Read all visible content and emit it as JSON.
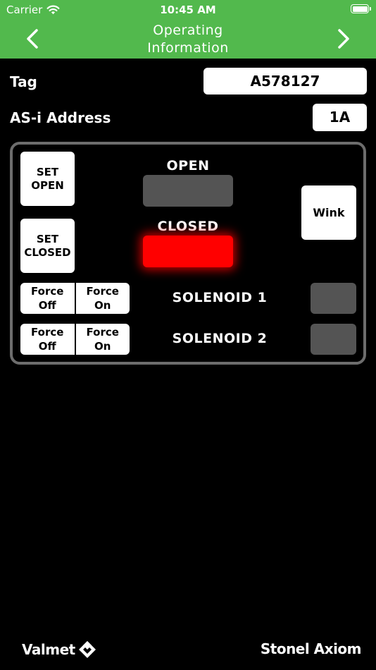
{
  "status_bar": {
    "carrier": "Carrier",
    "time": "10:45 AM"
  },
  "nav": {
    "title_line1": "Operating",
    "title_line2": "Information",
    "back_icon": "chevron-left-icon",
    "forward_icon": "chevron-right-icon"
  },
  "fields": {
    "tag_label": "Tag",
    "tag_value": "A578127",
    "address_label": "AS-i Address",
    "address_value": "1A"
  },
  "panel": {
    "set_open_line1": "SET",
    "set_open_line2": "OPEN",
    "set_closed_line1": "SET",
    "set_closed_line2": "CLOSED",
    "wink": "Wink",
    "open_label": "OPEN",
    "open_state": "off",
    "closed_label": "CLOSED",
    "closed_state": "on",
    "solenoids": [
      {
        "label": "SOLENOID 1",
        "force_off_1": "Force",
        "force_off_2": "Off",
        "force_on_1": "Force",
        "force_on_2": "On",
        "state": "off"
      },
      {
        "label": "SOLENOID 2",
        "force_off_1": "Force",
        "force_off_2": "Off",
        "force_on_1": "Force",
        "force_on_2": "On",
        "state": "off"
      }
    ]
  },
  "colors": {
    "header_green": "#52b94d",
    "lamp_off": "#545454",
    "lamp_on_red": "#ff0000",
    "panel_border": "#6d6d6d"
  },
  "footer": {
    "left_brand": "Valmet",
    "right_brand": "Stonel Axiom"
  }
}
